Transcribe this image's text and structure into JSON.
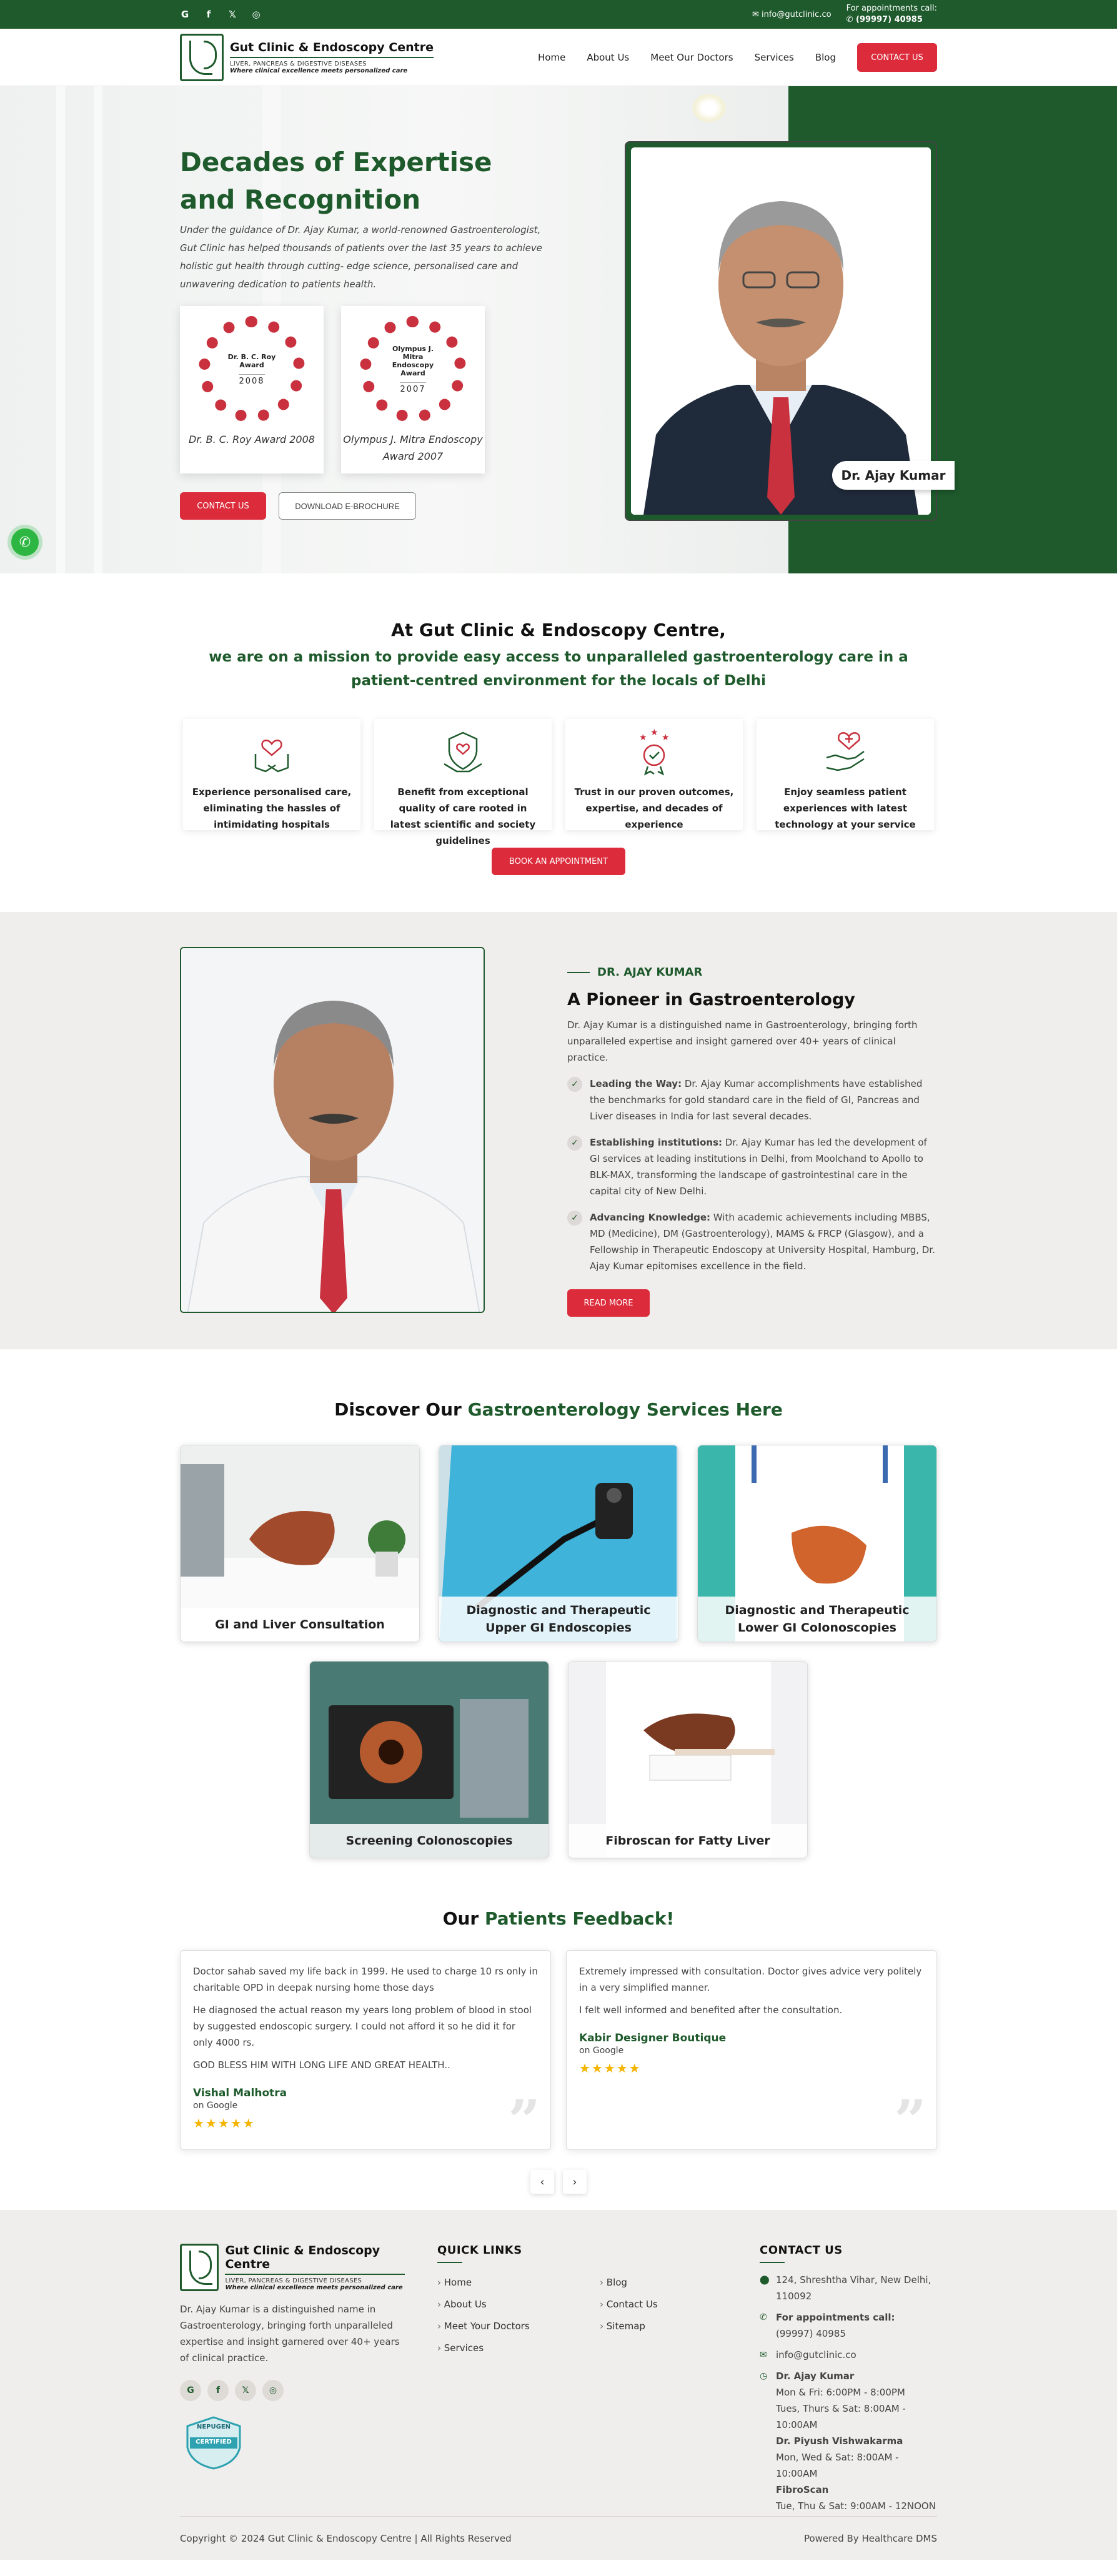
{
  "topbar": {
    "social": [
      "G",
      "f",
      "𝕏",
      "◎"
    ],
    "email": "info@gutclinic.co",
    "appt_label": "For appointments call:",
    "appt_phone": "(99997) 40985"
  },
  "brand": {
    "name": "Gut Clinic & Endoscopy Centre",
    "tagline": "LIVER, PANCREAS & DIGESTIVE DISEASES",
    "slogan": "Where clinical excellence meets personalized care"
  },
  "nav": {
    "items": [
      "Home",
      "About Us",
      "Meet Our Doctors",
      "Services",
      "Blog"
    ],
    "cta": "CONTACT US"
  },
  "hero": {
    "title": "Decades of Expertise and Recognition",
    "text": "Under the guidance of Dr. Ajay Kumar, a world-renowned Gastroenterologist, Gut Clinic has helped thousands of patients over the last 35 years to achieve holistic gut health through cutting- edge science, personalised care and unwavering dedication to patients health.",
    "awards": [
      {
        "badge": "Dr. B. C. Roy Award",
        "year": "2008",
        "caption": "Dr. B. C. Roy Award 2008"
      },
      {
        "badge": "Olympus J. Mitra Endoscopy Award",
        "year": "2007",
        "caption": "Olympus J. Mitra Endoscopy Award 2007"
      }
    ],
    "btn_contact": "CONTACT US",
    "btn_brochure": "DOWNLOAD E-BROCHURE",
    "doctor_name": "Dr. Ajay Kumar"
  },
  "mission": {
    "title": "At Gut Clinic & Endoscopy Centre,",
    "subtitle": "we are on a mission to provide easy access to unparalleled gastroenterology care in a patient-centred environment for the locals of Delhi",
    "features": [
      "Experience personalised care, eliminating the hassles of intimidating hospitals",
      "Benefit from exceptional quality of care rooted in latest scientific and society guidelines",
      "Trust in our proven outcomes, expertise, and decades of experience",
      "Enjoy seamless patient experiences with latest technology at your service"
    ],
    "cta": "BOOK AN APPOINTMENT"
  },
  "about": {
    "eyebrow": "DR. AJAY KUMAR",
    "title": "A Pioneer in Gastroenterology",
    "lead": "Dr. Ajay Kumar is a distinguished name in Gastroenterology, bringing forth unparalleled expertise and insight garnered over 40+ years of clinical practice.",
    "points": [
      {
        "head": "Leading the Way:",
        "text": " Dr. Ajay Kumar accomplishments have established the benchmarks for gold standard care in the field of GI, Pancreas and Liver diseases in India for last several decades."
      },
      {
        "head": "Establishing institutions:",
        "text": " Dr. Ajay Kumar has led the development of GI services at leading institutions in Delhi, from Moolchand to Apollo to BLK-MAX, transforming the landscape of gastrointestinal care in the capital city of New Delhi."
      },
      {
        "head": "Advancing Knowledge:",
        "text": " With academic achievements including MBBS, MD (Medicine), DM (Gastroenterology), MAMS & FRCP (Glasgow), and a Fellowship in Therapeutic Endoscopy at University Hospital, Hamburg, Dr. Ajay Kumar epitomises excellence in the field."
      }
    ],
    "cta": "READ MORE"
  },
  "services": {
    "title_a": "Discover Our ",
    "title_b": "Gastroenterology Services Here",
    "items": [
      "GI and Liver Consultation",
      "Diagnostic and Therapeutic Upper GI Endoscopies",
      "Diagnostic and Therapeutic Lower GI Colonoscopies",
      "Screening Colonoscopies",
      "Fibroscan for Fatty Liver"
    ]
  },
  "feedback": {
    "title_a": "Our ",
    "title_b": "Patients Feedback!",
    "cards": [
      {
        "p1": "Doctor sahab saved my life back in 1999. He used to charge 10 rs only in charitable OPD in deepak nursing home those days",
        "p2": "He diagnosed the actual reason my years long problem of blood in stool by suggested endoscopic surgery. I could not afford it so he did it for only 4000 rs.",
        "p3": "GOD BLESS HIM WITH LONG LIFE AND GREAT HEALTH..",
        "name": "Vishal Malhotra",
        "source": "on Google",
        "stars": "★★★★★"
      },
      {
        "p1": "Extremely impressed with consultation. Doctor gives advice very politely in a very simplified manner.",
        "p2": "I felt well informed and benefited after the consultation.",
        "p3": "",
        "name": "Kabir Designer Boutique",
        "source": "on Google",
        "stars": "★★★★★"
      }
    ],
    "prev": "‹",
    "next": "›"
  },
  "footer": {
    "about": "Dr. Ajay Kumar is a distinguished name in Gastroenterology, bringing forth unparalleled expertise and insight garnered over 40+ years of clinical practice.",
    "social": [
      "G",
      "f",
      "𝕏",
      "◎"
    ],
    "badge_top": "NEPUGEN",
    "badge_mid": "CERTIFIED",
    "quick_title": "QUICK LINKS",
    "links_a": [
      "Home",
      "About Us",
      "Meet Your Doctors",
      "Services"
    ],
    "links_b": [
      "Blog",
      "Contact Us",
      "Sitemap"
    ],
    "contact_title": "CONTACT US",
    "address": "124, Shreshtha Vihar, New Delhi, 110092",
    "appt_label": "For appointments call:",
    "appt_phone": "(99997) 40985",
    "email": "info@gutclinic.co",
    "hours": [
      {
        "name": "Dr. Ajay Kumar",
        "l1": "Mon & Fri: 6:00PM - 8:00PM",
        "l2": "Tues, Thurs & Sat: 8:00AM - 10:00AM"
      },
      {
        "name": "Dr. Piyush Vishwakarma",
        "l1": "Mon, Wed & Sat: 8:00AM - 10:00AM",
        "l2": ""
      },
      {
        "name": "FibroScan",
        "l1": "Tue, Thu & Sat: 9:00AM - 12NOON",
        "l2": ""
      }
    ],
    "copyright": "Copyright © 2024 Gut Clinic & Endoscopy Centre | All Rights Reserved",
    "powered": "Powered By Healthcare DMS"
  }
}
